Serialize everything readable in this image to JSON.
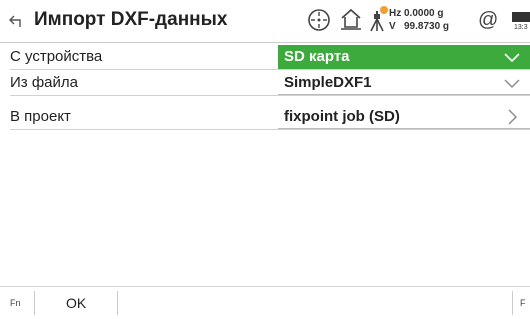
{
  "header": {
    "title": "Импорт DXF-данных",
    "hz_label": "Hz",
    "hz_value": "0.0000 g",
    "v_label": "V",
    "v_value": "99.8730 g",
    "at_symbol": "@",
    "time": "13:3"
  },
  "form": {
    "rows": [
      {
        "label": "С устройства",
        "value": "SD карта",
        "style": "green",
        "control": "dropdown"
      },
      {
        "label": "Из файла",
        "value": "SimpleDXF1",
        "style": "white",
        "control": "dropdown"
      },
      {
        "label": "В проект",
        "value": "fixpoint job (SD)",
        "style": "white",
        "control": "chevron-right"
      }
    ]
  },
  "footer": {
    "fn_label": "Fn",
    "ok_label": "OK",
    "right_label": "F"
  },
  "colors": {
    "accent_green": "#3caa3c",
    "alert_orange": "#f0a030"
  }
}
